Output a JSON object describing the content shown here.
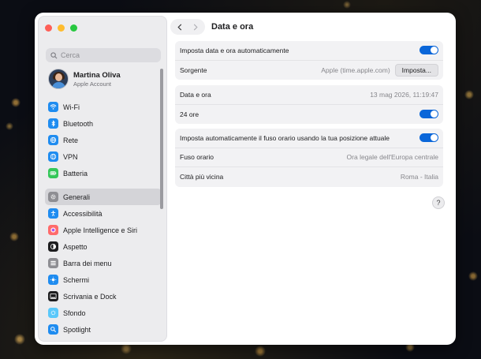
{
  "search": {
    "placeholder": "Cerca"
  },
  "account": {
    "name": "Martina Oliva",
    "subtitle": "Apple Account"
  },
  "sidebar": {
    "groups": [
      [
        {
          "label": "Wi-Fi",
          "icon": "wifi-icon",
          "color": "#1f8cf0"
        },
        {
          "label": "Bluetooth",
          "icon": "bluetooth-icon",
          "color": "#1f8cf0"
        },
        {
          "label": "Rete",
          "icon": "globe-icon",
          "color": "#1f8cf0"
        },
        {
          "label": "VPN",
          "icon": "vpn-globe-icon",
          "color": "#1f8cf0"
        },
        {
          "label": "Batteria",
          "icon": "battery-icon",
          "color": "#34c759"
        }
      ],
      [
        {
          "label": "Generali",
          "icon": "gear-icon",
          "color": "#8e8e93",
          "selected": true
        },
        {
          "label": "Accessibilità",
          "icon": "accessibility-icon",
          "color": "#1f8cf0"
        },
        {
          "label": "Apple Intelligence e Siri",
          "icon": "siri-icon",
          "color": "#ff6b6b"
        },
        {
          "label": "Aspetto",
          "icon": "appearance-icon",
          "color": "#1d1d1f"
        },
        {
          "label": "Barra dei menu",
          "icon": "menubar-icon",
          "color": "#8e8e93"
        },
        {
          "label": "Schermi",
          "icon": "display-icon",
          "color": "#1f8cf0"
        },
        {
          "label": "Scrivania e Dock",
          "icon": "dock-icon",
          "color": "#1d1d1f"
        },
        {
          "label": "Sfondo",
          "icon": "wallpaper-icon",
          "color": "#5ac8fa"
        },
        {
          "label": "Spotlight",
          "icon": "spotlight-icon",
          "color": "#1f8cf0"
        }
      ]
    ]
  },
  "header": {
    "title": "Data e ora"
  },
  "section1": {
    "auto_label": "Imposta data e ora automaticamente",
    "source_label": "Sorgente",
    "source_value": "Apple (time.apple.com)",
    "set_button": "Imposta..."
  },
  "section2": {
    "datetime_label": "Data e ora",
    "datetime_value": "13 mag 2026, 11:19:47",
    "h24_label": "24 ore"
  },
  "section3": {
    "auto_tz_label": "Imposta automaticamente il fuso orario usando la tua posizione attuale",
    "tz_label": "Fuso orario",
    "tz_value": "Ora legale dell'Europa centrale",
    "city_label": "Città più vicina",
    "city_value": "Roma - Italia"
  },
  "help_label": "?",
  "colors": {
    "accent": "#0a66d9",
    "sidebar_bg": "#ececee",
    "group_bg": "#f2f2f4"
  }
}
